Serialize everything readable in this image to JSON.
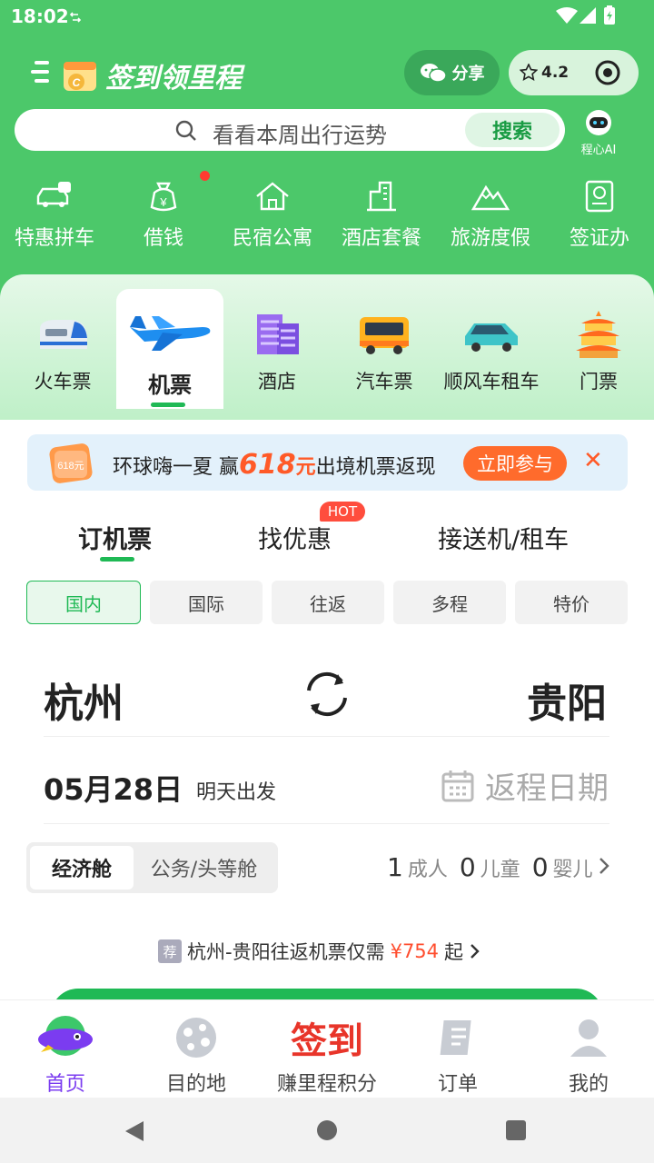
{
  "status_bar": {
    "time": "18:02"
  },
  "header": {
    "brand": "签到领里程",
    "share_label": "分享",
    "rating": "4.2"
  },
  "search": {
    "placeholder": "看看本周出行运势",
    "button": "搜索",
    "ai_label": "程心AI"
  },
  "quick_services": [
    {
      "label": "特惠拼车",
      "icon": "carpool-icon"
    },
    {
      "label": "借钱",
      "icon": "money-bag-icon",
      "badge_dot": true
    },
    {
      "label": "民宿公寓",
      "icon": "house-icon"
    },
    {
      "label": "酒店套餐",
      "icon": "building-icon"
    },
    {
      "label": "旅游度假",
      "icon": "mountain-icon"
    },
    {
      "label": "签证办",
      "icon": "passport-icon"
    }
  ],
  "main_tabs": [
    {
      "label": "火车票",
      "icon": "train-icon"
    },
    {
      "label": "机票",
      "icon": "airplane-icon",
      "active": true
    },
    {
      "label": "酒店",
      "icon": "hotel-icon"
    },
    {
      "label": "汽车票",
      "icon": "bus-icon"
    },
    {
      "label": "顺风车租车",
      "icon": "car-icon"
    },
    {
      "label": "门票",
      "icon": "temple-icon"
    }
  ],
  "promo": {
    "text_before": "环球嗨一夏 赢",
    "amount": "618",
    "unit": "元",
    "text_after": "出境机票返现",
    "cta": "立即参与",
    "icon_text": "618元"
  },
  "sub_tabs": {
    "book": "订机票",
    "deals": "找优惠",
    "hot_badge": "HOT",
    "transfer": "接送机/租车"
  },
  "trip_types": [
    "国内",
    "国际",
    "往返",
    "多程",
    "特价"
  ],
  "trip": {
    "from": "杭州",
    "to": "贵阳",
    "date": "05月28日",
    "date_note": "明天出发",
    "return_placeholder": "返程日期"
  },
  "cabin": {
    "economy": "经济舱",
    "business": "公务/头等舱"
  },
  "passengers": {
    "adults": "1",
    "adults_label": "成人",
    "children": "0",
    "children_label": "儿童",
    "infants": "0",
    "infants_label": "婴儿"
  },
  "recommend": {
    "tag": "荐",
    "text": "杭州-贵阳往返机票仅需",
    "price": "¥754",
    "suffix": "起"
  },
  "bottom_nav": [
    {
      "label": "首页",
      "active": true
    },
    {
      "label": "目的地"
    },
    {
      "label": "赚里程积分",
      "banner": "签到"
    },
    {
      "label": "订单"
    },
    {
      "label": "我的"
    }
  ],
  "colors": {
    "brand_green": "#4cc86a",
    "accent_green": "#1fb955",
    "promo_orange": "#ff6b2c",
    "active_purple": "#7b3cf0"
  }
}
